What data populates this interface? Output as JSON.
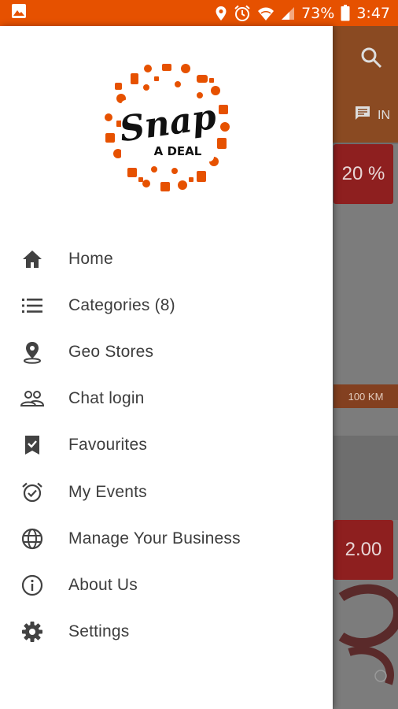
{
  "status_bar": {
    "battery": "73%",
    "time": "3:47"
  },
  "app": {
    "logo_text": {
      "main": "Snap",
      "sub": "A DEAL"
    },
    "brand_color": "#e65100"
  },
  "drawer_menu": {
    "items": [
      {
        "label": "Home",
        "icon": "home-icon"
      },
      {
        "label": "Categories (8)",
        "icon": "list-icon"
      },
      {
        "label": "Geo Stores",
        "icon": "location-pin-icon"
      },
      {
        "label": "Chat login",
        "icon": "people-icon"
      },
      {
        "label": "Favourites",
        "icon": "bookmark-check-icon"
      },
      {
        "label": "My Events",
        "icon": "alarm-check-icon"
      },
      {
        "label": "Manage Your Business",
        "icon": "globe-icon"
      },
      {
        "label": "About Us",
        "icon": "info-icon"
      },
      {
        "label": "Settings",
        "icon": "gear-icon"
      }
    ]
  },
  "background_content": {
    "chat_tab_label": "IN",
    "card1_price": "20 %",
    "card1_distance": "100 KM",
    "card2_price": "2.00"
  }
}
